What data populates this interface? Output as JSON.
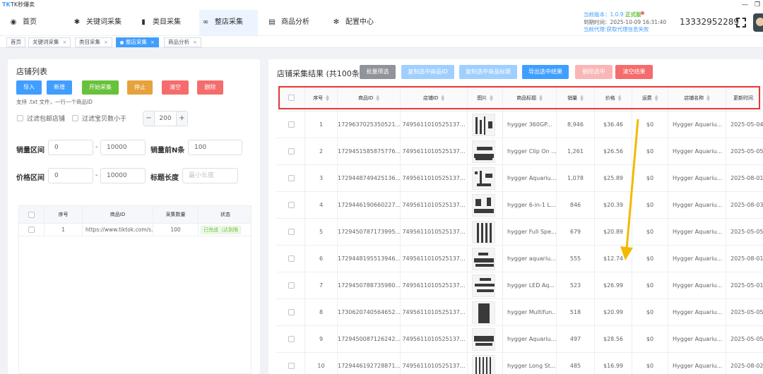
{
  "app": {
    "logo": "TK",
    "title": "TK秒爆卖"
  },
  "nav": [
    {
      "label": "首页",
      "icon": "dashboard-icon",
      "glyph": "◉"
    },
    {
      "label": "关键词采集",
      "icon": "bug-icon",
      "glyph": "✱"
    },
    {
      "label": "类目采集",
      "icon": "book-icon",
      "glyph": "▮"
    },
    {
      "label": "整店采集",
      "icon": "link-icon",
      "glyph": "∞"
    },
    {
      "label": "商品分析",
      "icon": "document-icon",
      "glyph": "▤"
    },
    {
      "label": "配置中心",
      "icon": "gear-icon",
      "glyph": "✻"
    }
  ],
  "version": {
    "version_prefix": "当前版本：1.0.9",
    "version_status": "正式版",
    "expire": "到期时间：2025-10-09 16:31:40",
    "agent": "当前代理:获取代理信息失败"
  },
  "user": {
    "phone": "13332952289"
  },
  "tabs": [
    {
      "label": "首页",
      "closable": false,
      "active": false
    },
    {
      "label": "关键词采集",
      "closable": true,
      "active": false
    },
    {
      "label": "类目采集",
      "closable": true,
      "active": false
    },
    {
      "label": "整店采集",
      "closable": true,
      "active": true
    },
    {
      "label": "商品分析",
      "closable": true,
      "active": false
    }
  ],
  "left": {
    "title": "店铺列表",
    "buttons": {
      "import": "导入",
      "add": "新增",
      "start": "开始采集",
      "stop": "停止",
      "clear": "清空",
      "delete": "删除"
    },
    "hint": "支持 .txt 文件，一行一个商品ID",
    "filter_free_shipping": "过滤包邮店铺",
    "filter_items_less": "过滤宝贝数小于",
    "stepper_value": "200",
    "sales_range_label": "销量区间",
    "sales_min": "0",
    "sales_max": "10000",
    "sales_topn_label": "销量前N条",
    "sales_topn_value": "100",
    "price_range_label": "价格区间",
    "price_min": "0",
    "price_max": "10000",
    "title_len_label": "标题长度",
    "title_len_placeholder": "最小长度",
    "table": {
      "headers": [
        "序号",
        "商品ID",
        "采集数量",
        "状态"
      ],
      "rows": [
        {
          "index": "1",
          "id": "https://www.tiktok.com/s...",
          "count": "100",
          "status": "已完成（达到限"
        }
      ]
    }
  },
  "right": {
    "title": "店铺采集结果 (共100条)",
    "buttons": {
      "batch": "批量筛选",
      "copy_ids": "复制选中商品ID",
      "copy_titles": "复制选中商品标题",
      "export": "导出选中结果",
      "delete_sel": "删除选中",
      "clear": "清空结果"
    },
    "headers": [
      "序号",
      "商品ID",
      "店铺ID",
      "图片",
      "商品标题",
      "销量",
      "价格",
      "运费",
      "店铺名称",
      "更新时间"
    ],
    "rows": [
      {
        "i": "1",
        "pid": "1729637025350521...",
        "sid": "7495611010525137...",
        "title": "hygger 360GP...",
        "sales": "8,946",
        "price": "$36.46",
        "ship": "$0",
        "shop": "Hygger Aquariu...",
        "time": "2025-05-04"
      },
      {
        "i": "2",
        "pid": "1729451585875776...",
        "sid": "7495611010525137...",
        "title": "hygger Clip On ...",
        "sales": "1,261",
        "price": "$26.56",
        "ship": "$0",
        "shop": "Hygger Aquariu...",
        "time": "2025-05-05"
      },
      {
        "i": "3",
        "pid": "1729448749425136...",
        "sid": "7495611010525137...",
        "title": "hygger Aquariu...",
        "sales": "1,078",
        "price": "$25.89",
        "ship": "$0",
        "shop": "Hygger Aquariu...",
        "time": "2025-08-01"
      },
      {
        "i": "4",
        "pid": "1729446190660227...",
        "sid": "7495611010525137...",
        "title": "hygger 6-in-1 L...",
        "sales": "846",
        "price": "$20.39",
        "ship": "$0",
        "shop": "Hygger Aquariu...",
        "time": "2025-08-03"
      },
      {
        "i": "5",
        "pid": "1729450787173995...",
        "sid": "7495611010525137...",
        "title": "hygger Full Spe...",
        "sales": "679",
        "price": "$20.89",
        "ship": "$0",
        "shop": "Hygger Aquariu...",
        "time": "2025-05-05"
      },
      {
        "i": "6",
        "pid": "1729448195513946...",
        "sid": "7495611010525137...",
        "title": "hygger aquariu...",
        "sales": "555",
        "price": "$12.74",
        "ship": "$0",
        "shop": "Hygger Aquariu...",
        "time": "2025-08-01"
      },
      {
        "i": "7",
        "pid": "1729450788735980...",
        "sid": "7495611010525137...",
        "title": "hygger LED Aq...",
        "sales": "523",
        "price": "$26.99",
        "ship": "$0",
        "shop": "Hygger Aquariu...",
        "time": "2025-05-01"
      },
      {
        "i": "8",
        "pid": "1730620740564652...",
        "sid": "7495611010525137...",
        "title": "hygger Multifun...",
        "sales": "518",
        "price": "$20.99",
        "ship": "$0",
        "shop": "Hygger Aquariu...",
        "time": "2025-05-05"
      },
      {
        "i": "9",
        "pid": "1729450087126242...",
        "sid": "7495611010525137...",
        "title": "hygger Aquariu...",
        "sales": "497",
        "price": "$28.56",
        "ship": "$0",
        "shop": "Hygger Aquariu...",
        "time": "2025-05-05"
      },
      {
        "i": "10",
        "pid": "1729446192728871...",
        "sid": "7495611010525137...",
        "title": "hygger Long St...",
        "sales": "485",
        "price": "$16.99",
        "ship": "$0",
        "shop": "Hygger Aquariu...",
        "time": "2025-08-02"
      }
    ]
  },
  "colors": {
    "primary": "#409eff",
    "success": "#67c23a",
    "warning": "#e6a23c",
    "danger": "#f56c6c",
    "annotation_red": "#e53935",
    "annotation_arrow": "#f5b800"
  }
}
